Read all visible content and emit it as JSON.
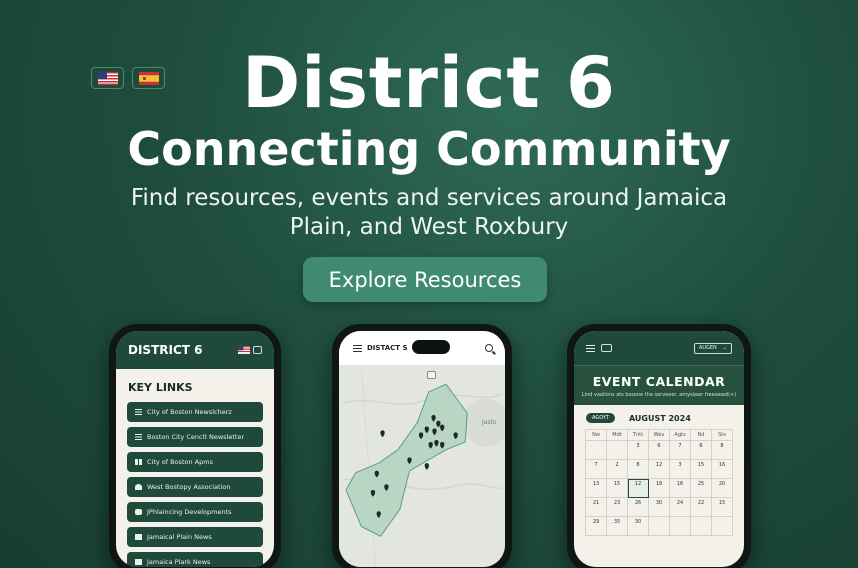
{
  "hero": {
    "title": "District 6",
    "subtitle": "Connecting  Community",
    "tagline": "Find resources, events and services around Jamaica Plain, and West Roxbury",
    "cta": "Explore Resources"
  },
  "languages": [
    {
      "icon": "us-flag-icon"
    },
    {
      "icon": "spain-flag-icon"
    }
  ],
  "phone_links": {
    "brand": "DISTRICT 6",
    "heading": "KEY LINKS",
    "links": [
      {
        "label": "City of Boston Newslcherz",
        "icon": "newsletter-icon"
      },
      {
        "label": "Boston City Cenclt Newsletter",
        "icon": "newsletter-icon"
      },
      {
        "label": "City of Boston Apms",
        "icon": "apps-icon"
      },
      {
        "label": "West Bostopy Association",
        "icon": "heart-icon"
      },
      {
        "label": "JPhlaincing Developments",
        "icon": "person-icon"
      },
      {
        "label": "Jamaical Plain News",
        "icon": "document-icon"
      },
      {
        "label": "Jamaica Plark News",
        "icon": "document-icon"
      }
    ]
  },
  "phone_map": {
    "brand": "DISTACT S",
    "map_label": "Jasto",
    "accent": "#1f4a3b"
  },
  "phone_calendar": {
    "language": "AUGEN",
    "title": "EVENT CALENDAR",
    "subtitle": "Lind vaalions ats bssone tha serveeer. amyslawr freeaawd(+)",
    "month_pill": "AGOYT",
    "month": "AUGUST 2024",
    "weekdays": [
      "Nw",
      "Mdt",
      "Tntt",
      "Wev",
      "Agts",
      "Nd",
      "Sts"
    ],
    "weeks": [
      [
        "",
        "",
        "3",
        "6",
        "7",
        "6",
        "8"
      ],
      [
        "7",
        "2",
        "8",
        "12",
        "3",
        "15",
        "16"
      ],
      [
        "13",
        "15",
        "12",
        "18",
        "16",
        "25",
        "20"
      ],
      [
        "21",
        "23",
        "26",
        "30",
        "24",
        "22",
        "15"
      ],
      [
        "29",
        "35",
        "30",
        "",
        "",
        "",
        ""
      ]
    ]
  }
}
